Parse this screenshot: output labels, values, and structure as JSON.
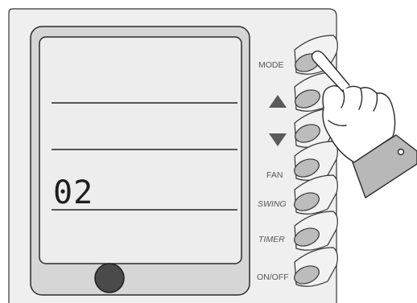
{
  "display": {
    "value": "02"
  },
  "buttons": {
    "mode": "MODE",
    "fan": "FAN",
    "swing": "SWING",
    "timer": "TIMER",
    "onoff": "ON/OFF",
    "up_icon": "triangle-up-icon",
    "down_icon": "triangle-down-icon"
  },
  "colors": {
    "panel": "#efefef",
    "screen": "#ededed",
    "outline": "#2a2a2a",
    "button_face": "#bcbcbc",
    "arrow": "#5a5a5a"
  }
}
